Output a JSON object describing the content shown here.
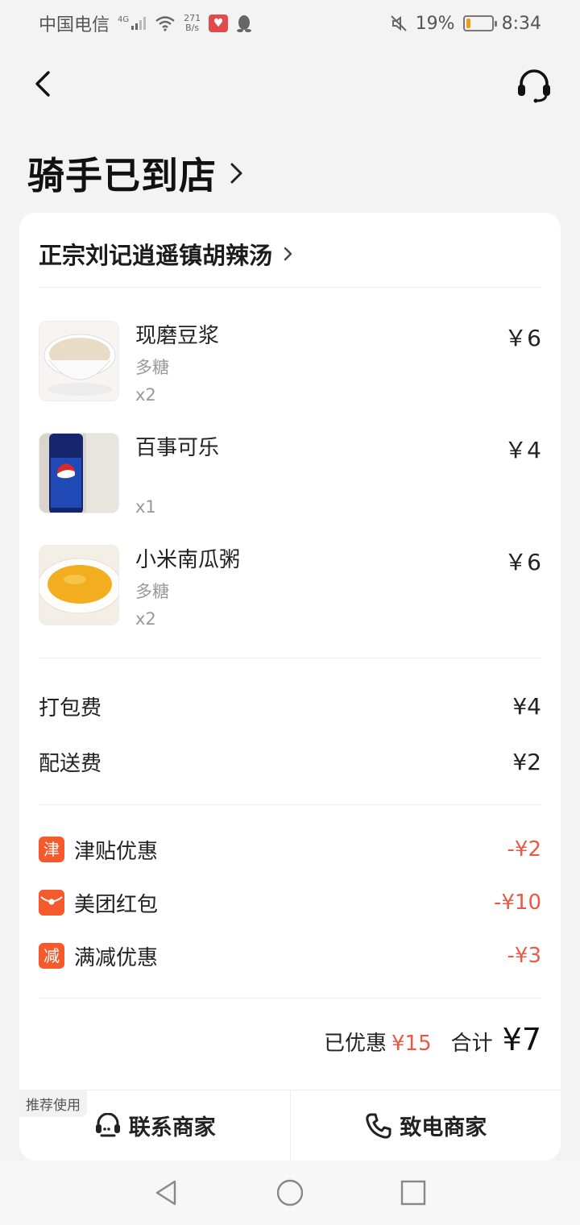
{
  "status_bar": {
    "carrier": "中国电信",
    "network": "4G",
    "speed_value": "271",
    "speed_unit": "B/s",
    "battery": "19%",
    "battery_level": 0.19,
    "time": "8:34"
  },
  "header": {
    "title": "骑手已到店"
  },
  "store": {
    "name": "正宗刘记逍遥镇胡辣汤"
  },
  "items": [
    {
      "name": "现磨豆浆",
      "spec": "多糖",
      "qty": "x2",
      "price": "￥6",
      "thumb": "soy-milk"
    },
    {
      "name": "百事可乐",
      "spec": "",
      "qty": "x1",
      "price": "￥4",
      "thumb": "pepsi"
    },
    {
      "name": "小米南瓜粥",
      "spec": "多糖",
      "qty": "x2",
      "price": "￥6",
      "thumb": "pumpkin-porridge"
    }
  ],
  "fees": [
    {
      "label": "打包费",
      "value": "¥4"
    },
    {
      "label": "配送费",
      "value": "¥2"
    }
  ],
  "discounts": [
    {
      "badge": "津",
      "label": "津贴优惠",
      "value": "-¥2",
      "icon": "allowance-icon"
    },
    {
      "badge": "",
      "label": "美团红包",
      "value": "-¥10",
      "icon": "red-packet-icon"
    },
    {
      "badge": "减",
      "label": "满减优惠",
      "value": "-¥3",
      "icon": "full-reduction-icon"
    }
  ],
  "summary": {
    "saved_label": "已优惠",
    "saved_value": "¥15",
    "total_label": "合计",
    "total_value": "¥7"
  },
  "actions": {
    "recommend_tag": "推荐使用",
    "contact": "联系商家",
    "call": "致电商家"
  },
  "colors": {
    "accent_red": "#e85a44",
    "badge_orange": "#f45a2b"
  }
}
